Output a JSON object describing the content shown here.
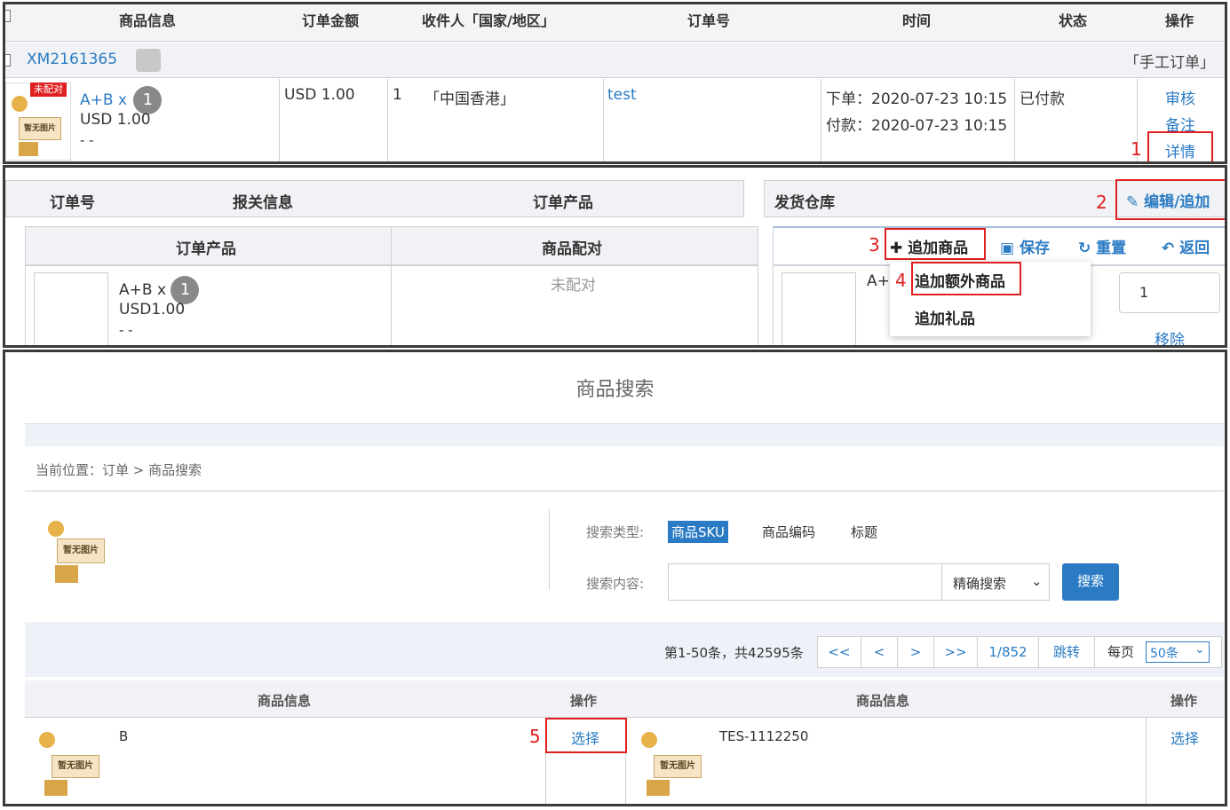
{
  "panel1": {
    "headers": [
      "商品信息",
      "订单金额",
      "收件人「国家/地区」",
      "订单号",
      "时间",
      "状态",
      "操作"
    ],
    "order_no": "XM2161365",
    "manual_tag": "「手工订单」",
    "unmatched_tag": "未配对",
    "product_name": "A+B x",
    "product_qty": "1",
    "product_price": "USD 1.00",
    "product_dash": "- -",
    "amount": "USD 1.00",
    "receiver_count": "1",
    "receiver_region": "「中国香港」",
    "order_id": "test",
    "time_order": "下单：2020-07-23 10:15",
    "time_paid": "付款：2020-07-23 10:15",
    "status": "已付款",
    "actions": [
      "审核",
      "备注",
      "详情"
    ],
    "no_image": "暂无图片"
  },
  "panel2": {
    "top_headers": [
      "订单号",
      "报关信息",
      "订单产品",
      "发货仓库"
    ],
    "edit_add": "编辑/追加",
    "sub_headers": [
      "订单产品",
      "商品配对"
    ],
    "toolbar": {
      "add_goods": "追加商品",
      "save": "保存",
      "reset": "重置",
      "back": "返回"
    },
    "dropdown": [
      "追加额外商品",
      "追加礼品"
    ],
    "product_name": "A+B x",
    "product_qty": "1",
    "product_price": "USD1.00",
    "product_dash": "- -",
    "match_status": "未配对",
    "right_product": "A+I",
    "qty_value": "1",
    "remove": "移除"
  },
  "panel3": {
    "title": "商品搜索",
    "breadcrumb": "当前位置：订单 > 商品搜索",
    "search_type_label": "搜索类型:",
    "search_types": [
      "商品SKU",
      "商品编码",
      "标题"
    ],
    "search_content_label": "搜索内容:",
    "search_input_value": "",
    "match_mode": "精确搜索",
    "search_button": "搜索",
    "pagination": {
      "summary": "第1-50条，共42595条",
      "first": "<<",
      "prev": "<",
      "next": ">",
      "last": ">>",
      "page": "1/852",
      "jump": "跳转",
      "per_page_label": "每页",
      "per_page": "50条"
    },
    "table_headers": [
      "商品信息",
      "操作",
      "商品信息",
      "操作"
    ],
    "rows": [
      {
        "name": "B",
        "action": "选择"
      },
      {
        "name": "TES-1112250",
        "action": "选择"
      }
    ],
    "no_image": "暂无图片"
  },
  "markers": [
    "1",
    "2",
    "3",
    "4",
    "5"
  ],
  "colors": {
    "link": "#2b7bc4",
    "marker": "#e02020",
    "primary_button": "#2b7bc4",
    "header_bg": "#eef1f5"
  }
}
